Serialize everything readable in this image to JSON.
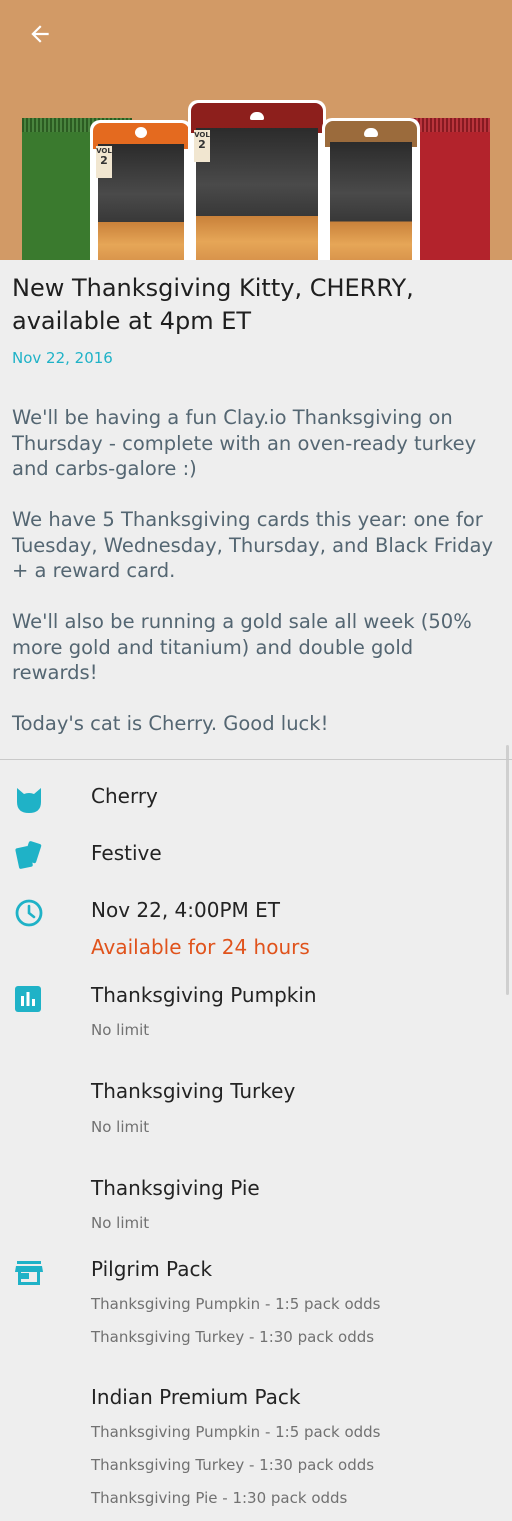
{
  "app": {
    "back_icon": "arrow-left-icon",
    "accent": "#1fb2c7",
    "warning": "#e0531c"
  },
  "post": {
    "title": "New Thanksgiving Kitty, CHERRY, available at 4pm ET",
    "date": "Nov 22, 2016",
    "paragraphs": [
      "We'll be having a fun Clay.io Thanksgiving on Thursday - complete with an oven-ready turkey and carbs-galore :)",
      "We have 5 Thanksgiving cards this year: one for Tuesday, Wednesday, Thursday, and Black Friday + a reward card.",
      "We'll also be running a gold sale all week (50% more gold and titanium) and double gold rewards!",
      "Today's cat is Cherry. Good luck!"
    ]
  },
  "hero": {
    "cards": [
      {
        "vol": "VOL",
        "num": "2"
      },
      {
        "vol": "VOL",
        "num": "2"
      }
    ]
  },
  "details": {
    "cat": {
      "icon": "cat-icon",
      "name": "Cherry"
    },
    "type": {
      "icon": "cards-icon",
      "name": "Festive"
    },
    "time": {
      "icon": "clock-icon",
      "when": "Nov 22, 4:00PM ET",
      "availability": "Available for 24 hours"
    },
    "cards": {
      "icon": "bar-chart-icon",
      "items": [
        {
          "name": "Thanksgiving Pumpkin",
          "limit": "No limit"
        },
        {
          "name": "Thanksgiving Turkey",
          "limit": "No limit"
        },
        {
          "name": "Thanksgiving Pie",
          "limit": "No limit"
        }
      ]
    },
    "packs": {
      "icon": "store-icon",
      "items": [
        {
          "name": "Pilgrim Pack",
          "odds": [
            "Thanksgiving Pumpkin - 1:5 pack odds",
            "Thanksgiving Turkey - 1:30 pack odds"
          ]
        },
        {
          "name": "Indian Premium Pack",
          "odds": [
            "Thanksgiving Pumpkin - 1:5 pack odds",
            "Thanksgiving Turkey - 1:30 pack odds",
            "Thanksgiving Pie - 1:30 pack odds"
          ]
        }
      ]
    }
  }
}
